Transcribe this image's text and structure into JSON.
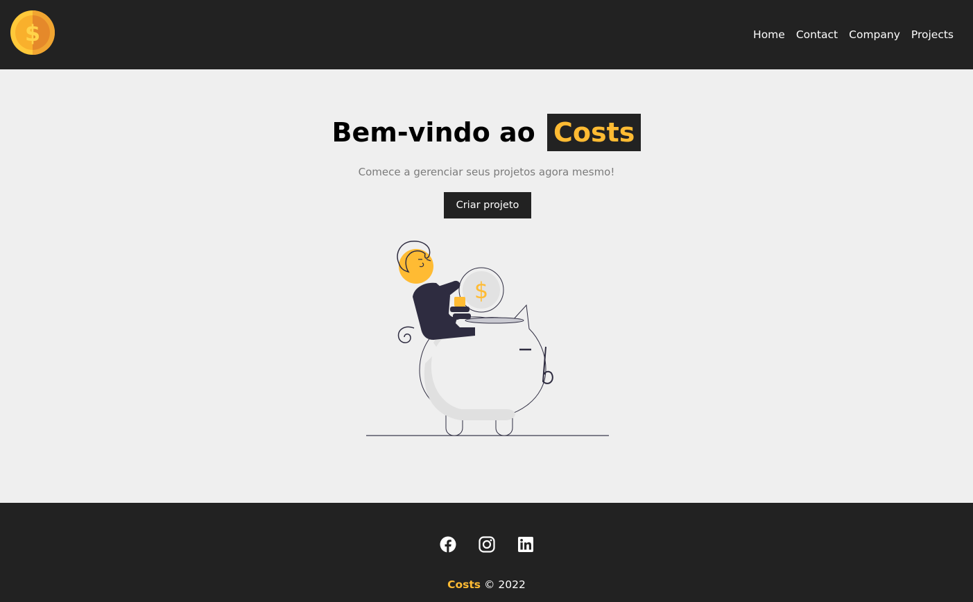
{
  "navbar": {
    "logo_icon": "dollar-coin-icon",
    "links": [
      "Home",
      "Contact",
      "Company",
      "Projects"
    ]
  },
  "hero": {
    "title_prefix": "Bem-vindo ao",
    "title_brand": "Costs",
    "subtitle": "Comece a gerenciar seus projetos agora mesmo!",
    "cta_label": "Criar projeto",
    "illustration_icon": "piggy-bank-savings-illustration",
    "illustration_coin_symbol": "$"
  },
  "footer": {
    "social_icons": [
      "facebook-icon",
      "instagram-icon",
      "linkedin-icon"
    ],
    "brand": "Costs",
    "copyright_text": "© 2022"
  },
  "colors": {
    "accent": "#ffbb33",
    "dark": "#222222",
    "background": "#efefef"
  }
}
